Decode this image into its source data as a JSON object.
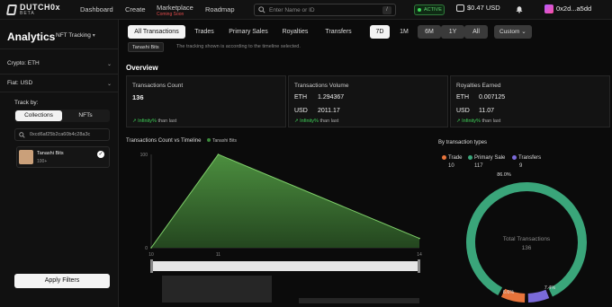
{
  "brand": {
    "name": "DUTCH0x",
    "beta": "BETA"
  },
  "nav": {
    "dashboard": "Dashboard",
    "create": "Create",
    "marketplace": "Marketplace",
    "marketplace_badge": "Coming Soon",
    "roadmap": "Roadmap"
  },
  "search": {
    "placeholder": "Enter Name or ID",
    "shortcut": "/"
  },
  "status": {
    "label": "ACTIVE"
  },
  "wallet": {
    "balance": "$0.47 USD"
  },
  "account": {
    "address": "0x2d...a5dd"
  },
  "sidebar": {
    "title": "Analytics",
    "mode": "NFT Tracking",
    "crypto": "Crypto: ETH",
    "fiat": "Fiat: USD",
    "track_by": "Track by:",
    "seg_collections": "Collections",
    "seg_nfts": "NFTs",
    "address": "0xcd6af25b2ca60b4c28a3c",
    "collection": {
      "name": "Tanashi Bits",
      "count": "100+"
    },
    "apply": "Apply Filters"
  },
  "tabs": [
    "All Transactions",
    "Trades",
    "Primary Sales",
    "Royalties",
    "Transfers"
  ],
  "periods": [
    "7D",
    "1M",
    "6M",
    "1Y",
    "All"
  ],
  "custom": "Custom",
  "chip": "Tanashi Bits",
  "note": "The tracking shown is according to the timeline selected.",
  "overview": "Overview",
  "cards": {
    "count": {
      "title": "Transactions Count",
      "value": "136",
      "change": "Infinity%",
      "suffix": "than last"
    },
    "volume": {
      "title": "Transactions Volume",
      "eth_label": "ETH",
      "eth": "1.294367",
      "usd_label": "USD",
      "usd": "2011.17",
      "change": "Infinity%",
      "suffix": "than last"
    },
    "royalties": {
      "title": "Royalties Earned",
      "eth_label": "ETH",
      "eth": "0.007125",
      "usd_label": "USD",
      "usd": "11.07",
      "change": "Infinity%",
      "suffix": "than last"
    }
  },
  "colors": {
    "accent_green": "#3ecf57",
    "trade": "#e8743b",
    "primary": "#3aa57a",
    "transfer": "#7a6ad8"
  },
  "chart_data": [
    {
      "type": "area",
      "title": "Transactions Count vs Timeline",
      "series": [
        {
          "name": "Tanashi Bits",
          "x": [
            10,
            11,
            14
          ],
          "values": [
            0,
            100,
            10
          ]
        }
      ],
      "yticks": [
        "0",
        "100"
      ],
      "xticks": [
        "10",
        "11",
        "14"
      ],
      "ylim": [
        0,
        100
      ]
    },
    {
      "type": "pie",
      "title": "By transaction types",
      "center_label": "Total Transactions",
      "center_value": "136",
      "categories": [
        "Trade",
        "Primary Sale",
        "Transfers"
      ],
      "values": [
        10,
        117,
        9
      ],
      "percent_labels": [
        "7.4%",
        "86.0%",
        "6.6%"
      ]
    }
  ]
}
